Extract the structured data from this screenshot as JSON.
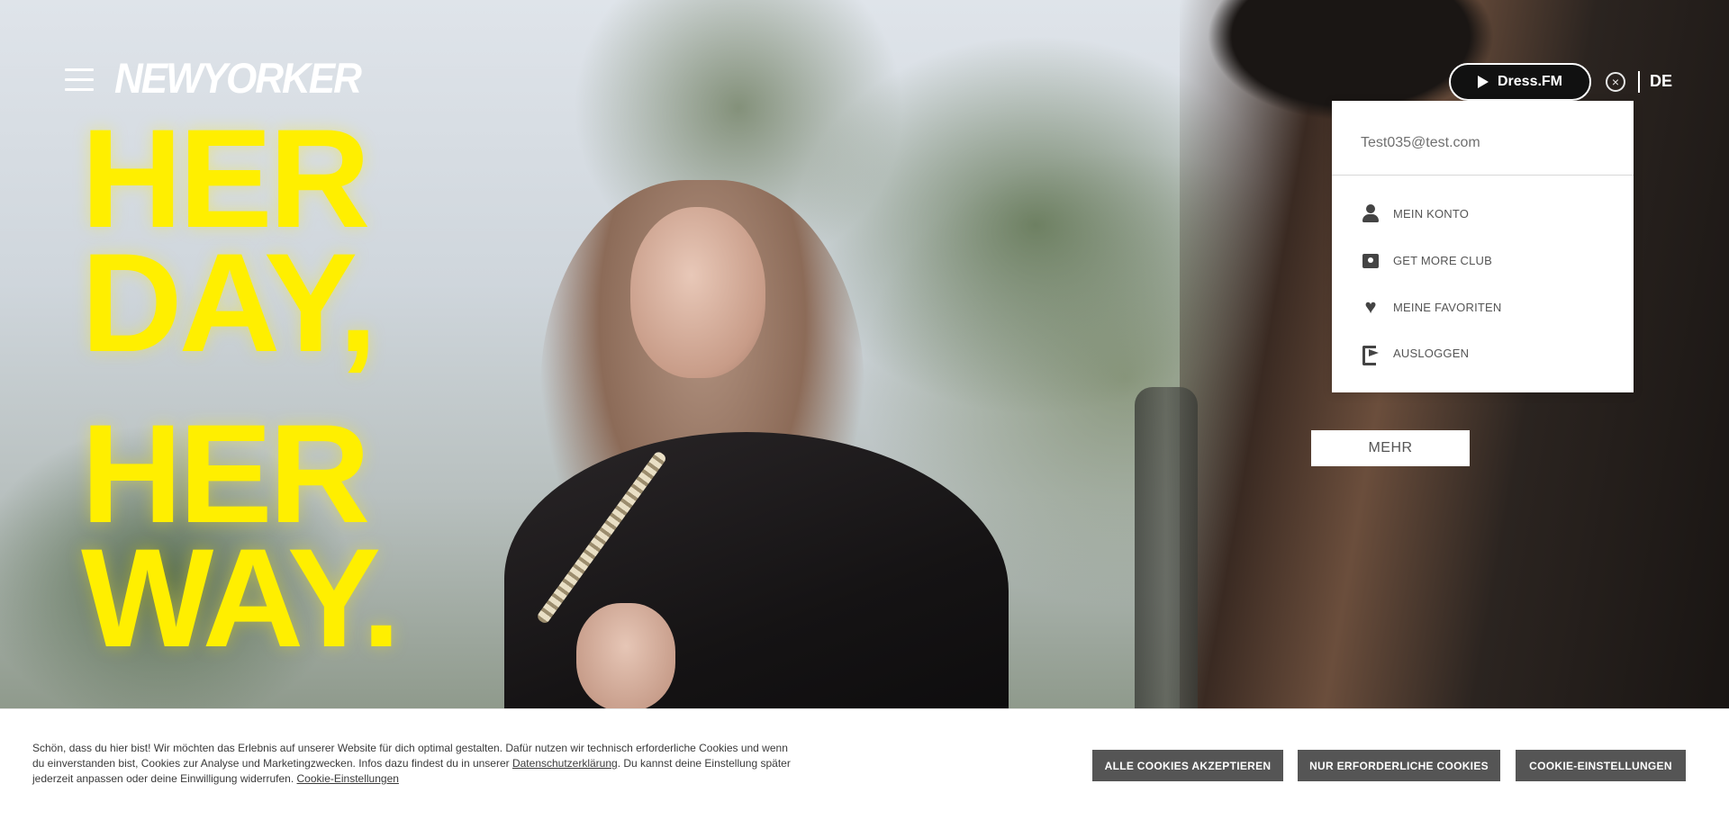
{
  "header": {
    "logo_text": "NEWYORKER",
    "dressfm_label": "Dress.FM",
    "close_glyph": "×",
    "language": "DE"
  },
  "hero": {
    "headline_lines": [
      "HER",
      "DAY,",
      "HER",
      "WAY."
    ],
    "more_label": "MEHR"
  },
  "account_menu": {
    "email": "Test035@test.com",
    "items": [
      {
        "label": "MEIN KONTO",
        "icon": "user-icon"
      },
      {
        "label": "GET MORE CLUB",
        "icon": "club-card-icon"
      },
      {
        "label": "MEINE FAVORITEN",
        "icon": "heart-icon"
      },
      {
        "label": "AUSLOGGEN",
        "icon": "logout-icon"
      }
    ]
  },
  "cookie_banner": {
    "text_part1": "Schön, dass du hier bist! Wir möchten das Erlebnis auf unserer Website für dich optimal gestalten. Dafür nutzen wir technisch erforderliche Cookies und wenn du einverstanden bist, Cookies zur Analyse und Marketingzwecken. Infos dazu findest du in unserer ",
    "privacy_link": "Datenschutzerklärung",
    "text_part2": ". Du kannst deine Einstellung später jederzeit anpassen oder deine Einwilligung widerrufen. ",
    "settings_link": "Cookie-Einstellungen",
    "buttons": {
      "accept_all": "ALLE COOKIES AKZEPTIEREN",
      "required_only": "NUR ERFORDERLICHE COOKIES",
      "settings": "COOKIE-EINSTELLUNGEN"
    }
  },
  "colors": {
    "headline": "#ffef00",
    "cookie_button": "#555555",
    "dressfm_button": "#111111"
  }
}
